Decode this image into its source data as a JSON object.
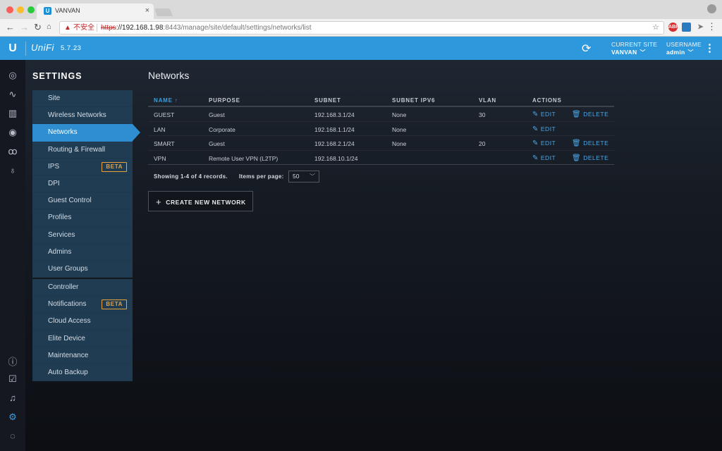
{
  "browser": {
    "tab_title": "VANVAN",
    "tab_favicon": "U",
    "insecure_label": "不安全",
    "url_scheme": "https",
    "url_host": "://192.168.1.98",
    "url_rest": ":8443/manage/site/default/settings/networks/list",
    "ext_abp": "ABP"
  },
  "app": {
    "logo_letter": "U",
    "logo_text": "UniFi",
    "version": "5.7.23",
    "current_site_label": "CURRENT SITE",
    "current_site_value": "VANVAN",
    "username_label": "USERNAME",
    "username_value": "admin",
    "accent": "#2e98dc"
  },
  "rail_icons": [
    "dashboard-icon",
    "statistics-icon",
    "map-icon",
    "devices-icon",
    "clients-icon",
    "insights-icon",
    "info-icon",
    "tasks-icon",
    "alerts-icon",
    "settings-icon",
    "chat-icon"
  ],
  "settings": {
    "title": "SETTINGS",
    "group1": [
      {
        "label": "Site"
      },
      {
        "label": "Wireless Networks"
      },
      {
        "label": "Networks",
        "active": true
      },
      {
        "label": "Routing & Firewall"
      },
      {
        "label": "IPS",
        "badge": "BETA"
      },
      {
        "label": "DPI"
      },
      {
        "label": "Guest Control"
      },
      {
        "label": "Profiles"
      },
      {
        "label": "Services"
      },
      {
        "label": "Admins"
      },
      {
        "label": "User Groups"
      }
    ],
    "group2": [
      {
        "label": "Controller"
      },
      {
        "label": "Notifications",
        "badge": "BETA"
      },
      {
        "label": "Cloud Access"
      },
      {
        "label": "Elite Device"
      },
      {
        "label": "Maintenance"
      },
      {
        "label": "Auto Backup"
      }
    ]
  },
  "main": {
    "title": "Networks",
    "columns": {
      "name": "NAME",
      "purpose": "PURPOSE",
      "subnet": "SUBNET",
      "subnet_ipv6": "SUBNET IPV6",
      "vlan": "VLAN",
      "actions": "ACTIONS"
    },
    "sort_arrow": "↑",
    "rows": [
      {
        "name": "GUEST",
        "purpose": "Guest",
        "subnet": "192.168.3.1/24",
        "ipv6": "None",
        "vlan": "30",
        "edit": "EDIT",
        "delete": "DELETE"
      },
      {
        "name": "LAN",
        "purpose": "Corporate",
        "subnet": "192.168.1.1/24",
        "ipv6": "None",
        "vlan": "",
        "edit": "EDIT",
        "delete": ""
      },
      {
        "name": "SMART",
        "purpose": "Guest",
        "subnet": "192.168.2.1/24",
        "ipv6": "None",
        "vlan": "20",
        "edit": "EDIT",
        "delete": "DELETE"
      },
      {
        "name": "VPN",
        "purpose": "Remote User VPN (L2TP)",
        "subnet": "192.168.10.1/24",
        "ipv6": "",
        "vlan": "",
        "edit": "EDIT",
        "delete": "DELETE"
      }
    ],
    "showing": "Showing 1-4 of 4 records.",
    "per_page_label": "Items per page:",
    "per_page_value": "50",
    "create_label": "CREATE NEW NETWORK"
  }
}
